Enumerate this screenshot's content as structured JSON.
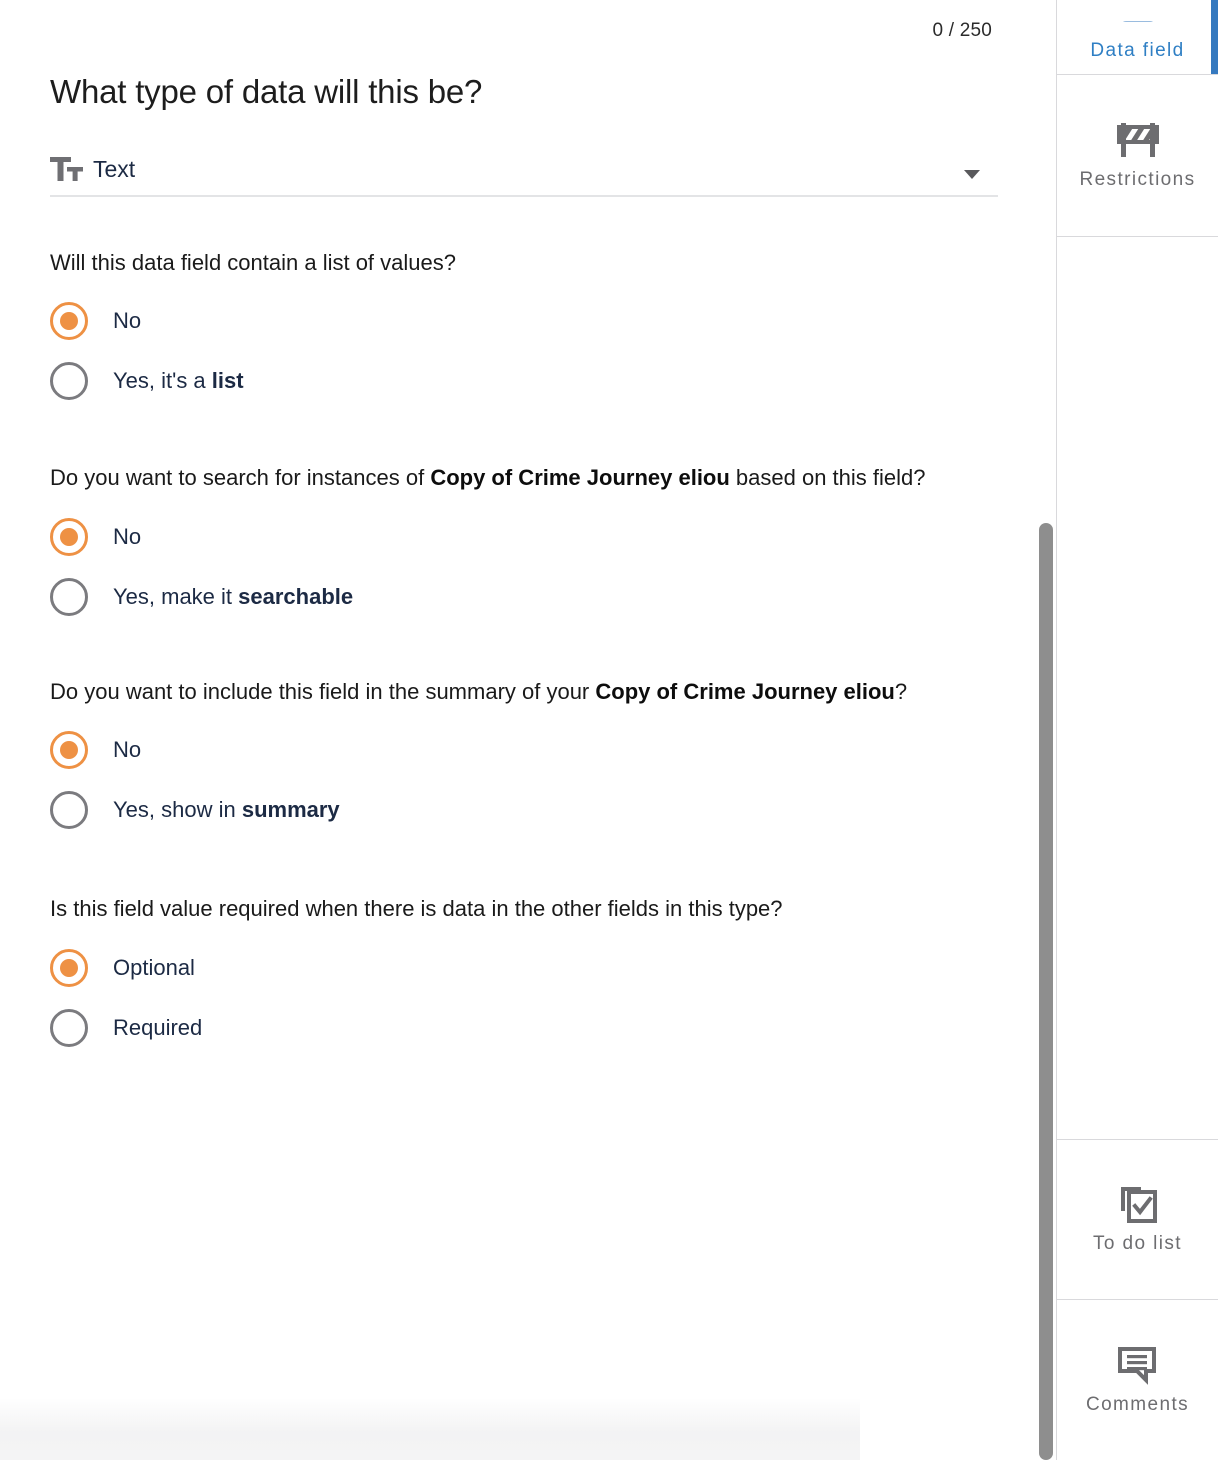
{
  "main": {
    "char_counter": "0 / 250",
    "page_title": "What type of data will this be?",
    "type_select": {
      "icon": "text-format-icon",
      "value": "Text",
      "caret": "chevron-down-icon"
    },
    "questions": [
      {
        "id": "list-of-values",
        "text_parts": [
          {
            "text": "Will this data field contain a list of values?",
            "bold": false
          }
        ],
        "options": [
          {
            "label_parts": [
              {
                "text": "No",
                "bold": false
              }
            ],
            "checked": true
          },
          {
            "label_parts": [
              {
                "text": "Yes, it's a ",
                "bold": false
              },
              {
                "text": "list",
                "bold": true
              }
            ],
            "checked": false
          }
        ]
      },
      {
        "id": "searchable",
        "text_parts": [
          {
            "text": "Do you want to search for instances of ",
            "bold": false
          },
          {
            "text": "Copy of Crime Journey eliou",
            "bold": true
          },
          {
            "text": " based on this field?",
            "bold": false
          }
        ],
        "options": [
          {
            "label_parts": [
              {
                "text": "No",
                "bold": false
              }
            ],
            "checked": true
          },
          {
            "label_parts": [
              {
                "text": "Yes, make it ",
                "bold": false
              },
              {
                "text": "searchable",
                "bold": true
              }
            ],
            "checked": false
          }
        ]
      },
      {
        "id": "summary",
        "text_parts": [
          {
            "text": "Do you want to include this field in the summary of your ",
            "bold": false
          },
          {
            "text": "Copy of Crime Journey eliou",
            "bold": true
          },
          {
            "text": "?",
            "bold": false
          }
        ],
        "options": [
          {
            "label_parts": [
              {
                "text": "No",
                "bold": false
              }
            ],
            "checked": true
          },
          {
            "label_parts": [
              {
                "text": "Yes, show in ",
                "bold": false
              },
              {
                "text": "summary",
                "bold": true
              }
            ],
            "checked": false
          }
        ]
      },
      {
        "id": "required",
        "text_parts": [
          {
            "text": "Is this field value required when there is data in the other fields in this type?",
            "bold": false
          }
        ],
        "options": [
          {
            "label_parts": [
              {
                "text": "Optional",
                "bold": false
              }
            ],
            "checked": true
          },
          {
            "label_parts": [
              {
                "text": "Required",
                "bold": false
              }
            ],
            "checked": false
          }
        ]
      }
    ]
  },
  "sidebar": {
    "items": [
      {
        "label": "Data field",
        "icon": "data-field-icon",
        "active": true
      },
      {
        "label": "Restrictions",
        "icon": "barricade-icon",
        "active": false
      },
      {
        "label": "To do list",
        "icon": "checklist-copy-icon",
        "active": false
      },
      {
        "label": "Comments",
        "icon": "comment-bubble-icon",
        "active": false
      }
    ]
  },
  "colors": {
    "accent_orange": "#ee9144",
    "accent_blue": "#3579bf",
    "label_navy": "#1c2a44",
    "icon_gray": "#6d6d70",
    "scrollbar": "#8e8e8e"
  }
}
